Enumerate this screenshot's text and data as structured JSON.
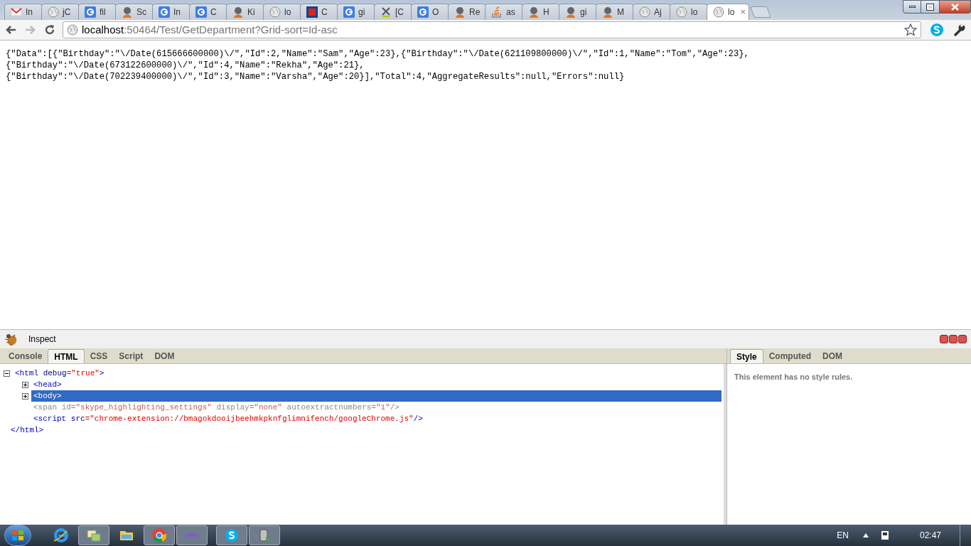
{
  "tabs": [
    {
      "title": "In",
      "kind": "gmail",
      "selected": false
    },
    {
      "title": "jC",
      "kind": "globe",
      "selected": false
    },
    {
      "title": "fil",
      "kind": "google",
      "selected": false
    },
    {
      "title": "Sc",
      "kind": "avatar",
      "selected": false
    },
    {
      "title": "In",
      "kind": "google",
      "selected": false
    },
    {
      "title": "C",
      "kind": "google",
      "selected": false
    },
    {
      "title": "Ki",
      "kind": "avatar",
      "selected": false
    },
    {
      "title": "lo",
      "kind": "globe",
      "selected": false
    },
    {
      "title": "C",
      "kind": "square",
      "selected": false
    },
    {
      "title": "gi",
      "kind": "google",
      "selected": false
    },
    {
      "title": "[C",
      "kind": "cross",
      "selected": false
    },
    {
      "title": "O",
      "kind": "google",
      "selected": false
    },
    {
      "title": "Re",
      "kind": "avatar",
      "selected": false
    },
    {
      "title": "as",
      "kind": "stack",
      "selected": false
    },
    {
      "title": "H",
      "kind": "avatar",
      "selected": false
    },
    {
      "title": "gi",
      "kind": "avatar",
      "selected": false
    },
    {
      "title": "M",
      "kind": "avatar",
      "selected": false
    },
    {
      "title": "Aj",
      "kind": "globe",
      "selected": false
    },
    {
      "title": "lo",
      "kind": "globe",
      "selected": false
    },
    {
      "title": "lo",
      "kind": "globe",
      "selected": true,
      "close": "×"
    }
  ],
  "address": {
    "host": "localhost",
    "rest": ":50464/Test/GetDepartment?Grid-sort=Id-asc"
  },
  "page_lines": [
    "{\"Data\":[{\"Birthday\":\"\\/Date(615666600000)\\/\",\"Id\":2,\"Name\":\"Sam\",\"Age\":23},{\"Birthday\":\"\\/Date(621109800000)\\/\",\"Id\":1,\"Name\":\"Tom\",\"Age\":23},",
    "{\"Birthday\":\"\\/Date(673122600000)\\/\",\"Id\":4,\"Name\":\"Rekha\",\"Age\":21},",
    "{\"Birthday\":\"\\/Date(702239400000)\\/\",\"Id\":3,\"Name\":\"Varsha\",\"Age\":20}],\"Total\":4,\"AggregateResults\":null,\"Errors\":null}"
  ],
  "devtools": {
    "inspect": "Inspect",
    "tabs": [
      {
        "label": "Console",
        "selected": false
      },
      {
        "label": "HTML",
        "selected": true
      },
      {
        "label": "CSS",
        "selected": false
      },
      {
        "label": "Script",
        "selected": false
      },
      {
        "label": "DOM",
        "selected": false
      }
    ],
    "tree": {
      "open": "<html",
      "attrs": [
        {
          "name": "debug",
          "value": "=\"true\""
        }
      ],
      "end": ">",
      "expanded": true,
      "close": "</html>",
      "children": [
        {
          "open": "<head>",
          "expanded": false,
          "selected": false,
          "dimmed": false
        },
        {
          "open": "<body>",
          "expanded": false,
          "selected": true,
          "dimmed": false
        },
        {
          "open": "<span",
          "attrs": [
            {
              "name": "id",
              "value": "=\"skype_highlighting_settings\""
            },
            {
              "name": "display",
              "value": "=\"none\""
            },
            {
              "name": "autoextractnumbers",
              "value": "=\"1\""
            }
          ],
          "end": "/>",
          "selected": false,
          "dimmed": true
        },
        {
          "open": "<script",
          "attrs": [
            {
              "name": "src",
              "value": "=\"chrome-extension://bmagokdooijbeehmkpknfglimnifench/googleChrome.js\""
            }
          ],
          "end": "/>",
          "selected": false,
          "dimmed": false
        }
      ]
    },
    "side_tabs": [
      {
        "label": "Style",
        "selected": true
      },
      {
        "label": "Computed",
        "selected": false
      },
      {
        "label": "DOM",
        "selected": false
      }
    ],
    "side_message": "This element has no style rules."
  },
  "taskbar": {
    "apps": [
      {
        "kind": "ie",
        "active": false
      },
      {
        "kind": "folders",
        "active": true
      },
      {
        "kind": "explorer",
        "active": false
      },
      {
        "kind": "chrome",
        "active": true
      },
      {
        "kind": "infinity",
        "active": true
      },
      {
        "kind": "skype",
        "active": true
      },
      {
        "kind": "db",
        "active": true
      }
    ],
    "language": "EN",
    "time": "02:47"
  }
}
